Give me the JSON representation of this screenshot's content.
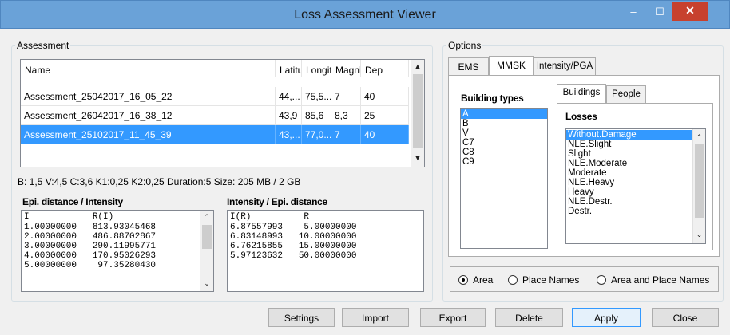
{
  "window": {
    "title": "Loss Assessment Viewer",
    "min_glyph": "–",
    "max_glyph": "☐",
    "close_glyph": "✕"
  },
  "assessment": {
    "legend": "Assessment",
    "columns": [
      "Name",
      "Latitu",
      "Longit",
      "Magni",
      "Dep"
    ],
    "rows": [
      [
        "Assessment_25042017_16_05_22",
        "44,...",
        "75,5...",
        "7",
        "40"
      ],
      [
        "Assessment_26042017_16_38_12",
        "43,9",
        "85,6",
        "8,3",
        "25"
      ],
      [
        "Assessment_25102017_11_45_39",
        "43,...",
        "77,0...",
        "7",
        "40"
      ]
    ],
    "selected_row": 2,
    "status": "B: 1,5  V:4,5  C:3,6  K1:0,25  K2:0,25  Duration:5  Size: 205 MB / 2 GB",
    "epi_title": "Epi. distance / Intensity",
    "epi_header": "I            R(I)",
    "epi_rows": [
      "1.00000000   813.93045468",
      "2.00000000   486.88702867",
      "3.00000000   290.11995771",
      "4.00000000   170.95026293",
      "5.00000000    97.35280430"
    ],
    "int_title": "Intensity / Epi. distance",
    "int_header": "I(R)          R",
    "int_rows": [
      "6.87557993    5.00000000",
      "6.83148993   10.00000000",
      "6.76215855   15.00000000",
      "5.97123632   50.00000000"
    ]
  },
  "options": {
    "legend": "Options",
    "tabs": [
      "EMS",
      "MMSK",
      "Intensity/PGA"
    ],
    "active_tab": "MMSK",
    "building_types_label": "Building types",
    "building_types": [
      "A",
      "B",
      "V",
      "C7",
      "C8",
      "C9"
    ],
    "selected_building": "A",
    "inner_tabs": [
      "Buildings",
      "People"
    ],
    "losses_label": "Losses",
    "losses": [
      "Without.Damage",
      "NLE.Slight",
      "Slight",
      "NLE.Moderate",
      "Moderate",
      "NLE.Heavy",
      "Heavy",
      "NLE.Destr.",
      "Destr."
    ],
    "selected_loss": "Without.Damage",
    "radios": [
      "Area",
      "Place Names",
      "Area and Place Names"
    ],
    "selected_radio": "Area"
  },
  "buttons": {
    "settings": "Settings",
    "import": "Import",
    "export": "Export",
    "delete": "Delete",
    "apply": "Apply",
    "close": "Close"
  }
}
